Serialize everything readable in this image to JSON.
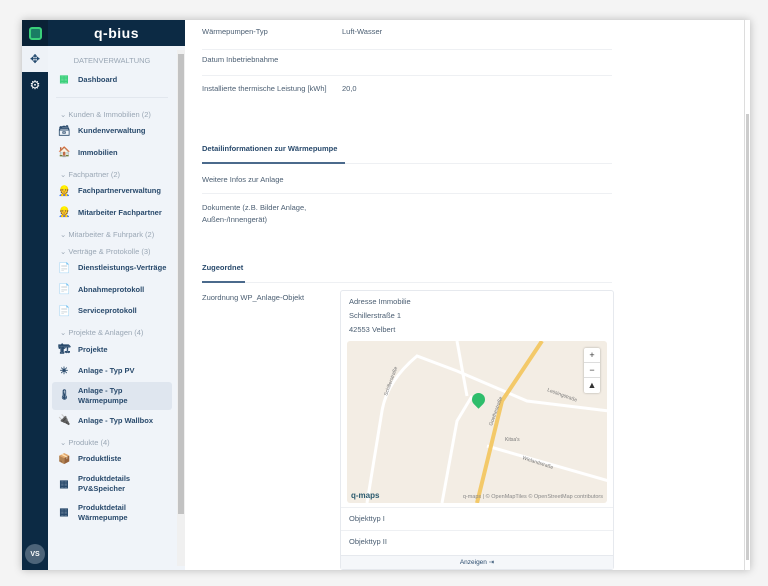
{
  "app": {
    "brand": "q-bius",
    "user_initials": "VS"
  },
  "sidebar": {
    "section": "DATENVERWALTUNG",
    "dashboard": "Dashboard",
    "groups": [
      {
        "label": "Kunden & Immobilien (2)",
        "items": [
          {
            "label": "Kundenverwaltung",
            "icon": "🗃"
          },
          {
            "label": "Immobilien",
            "icon": "🏠"
          }
        ]
      },
      {
        "label": "Fachpartner (2)",
        "items": [
          {
            "label": "Fachpartnerverwaltung",
            "icon": "👷"
          },
          {
            "label": "Mitarbeiter Fachpartner",
            "icon": "👷"
          }
        ]
      },
      {
        "label": "Mitarbeiter & Fuhrpark (2)",
        "items": []
      },
      {
        "label": "Verträge & Protokolle (3)",
        "items": [
          {
            "label": "Dienstleistungs-Verträge",
            "icon": "📄"
          },
          {
            "label": "Abnahmeprotokoll",
            "icon": "📄"
          },
          {
            "label": "Serviceprotokoll",
            "icon": "📄"
          }
        ]
      },
      {
        "label": "Projekte & Anlagen (4)",
        "items": [
          {
            "label": "Projekte",
            "icon": "🏗"
          },
          {
            "label": "Anlage - Typ PV",
            "icon": "☀"
          },
          {
            "label": "Anlage - Typ Wärmepumpe",
            "icon": "🌡",
            "active": true
          },
          {
            "label": "Anlage - Typ Wallbox",
            "icon": "🔌"
          }
        ]
      },
      {
        "label": "Produkte (4)",
        "items": [
          {
            "label": "Produktliste",
            "icon": "📦"
          },
          {
            "label": "Produktdetails PV&Speicher",
            "icon": "▦"
          },
          {
            "label": "Produktdetail Wärmepumpe",
            "icon": "▦"
          }
        ]
      }
    ]
  },
  "fields": {
    "typ_label": "Wärmepumpen-Typ",
    "typ_value": "Luft-Wasser",
    "datum_label": "Datum Inbetriebnahme",
    "leistung_label": "Installierte thermische Leistung [kWh]",
    "leistung_value": "20,0",
    "detail_heading": "Detailinformationen zur Wärmepumpe",
    "infos_label": "Weitere Infos zur Anlage",
    "dokumente_label": "Dokumente (z.B. Bilder Anlage, Außen-/Innengerät)",
    "zugeordnet_heading": "Zugeordnet",
    "zuordnung_label": "Zuordnung WP_Anlage-Objekt"
  },
  "card": {
    "address_label": "Adresse Immobilie",
    "street": "Schillerstraße 1",
    "city": "42553 Velbert",
    "map_attribution": "q-maps | © OpenMapTiles © OpenStreetMap contributors",
    "map_logo": "q-maps",
    "streets": [
      "Schillerstraße",
      "Lessingstraße",
      "Wielandstraße",
      "Goethestraße",
      "Kitsa's"
    ],
    "objekttyp1": "Objekttyp I",
    "objekttyp2": "Objekttyp II",
    "show_button": "Anzeigen"
  }
}
